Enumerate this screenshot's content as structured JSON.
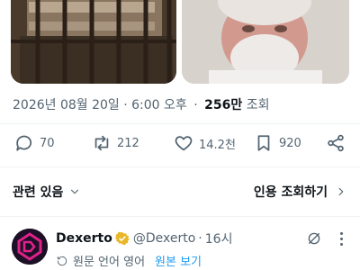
{
  "post": {
    "timestamp": "2026년 08월 20일 · 6:00 오후",
    "separator": "·",
    "views_count": "256만",
    "views_label": "조회"
  },
  "actions": {
    "reply_count": "70",
    "retweet_count": "212",
    "like_count": "14.2천",
    "bookmark_count": "920"
  },
  "related": {
    "label": "관련 있음",
    "view_quotes_label": "인용 조회하기"
  },
  "next_tweet": {
    "name": "Dexerto",
    "handle": "@Dexerto",
    "dot": "·",
    "time": "16시",
    "translated_notice": "원문 언어 영어",
    "show_original_label": "원본 보기"
  },
  "colors": {
    "text_primary": "#0f1419",
    "text_secondary": "#536471",
    "accent": "#1d9bf0",
    "verified_gold": "#e8b829",
    "avatar_magenta": "#e0218a"
  },
  "icons": {
    "reply": "reply-icon",
    "retweet": "retweet-icon",
    "like": "heart-icon",
    "bookmark": "bookmark-icon",
    "share": "share-icon",
    "related_toggle": "chevron-down-icon",
    "quotes_arrow": "chevron-right-icon",
    "verified": "verified-badge-icon",
    "grok": "grok-icon",
    "more": "more-icon",
    "translate": "translate-icon"
  }
}
